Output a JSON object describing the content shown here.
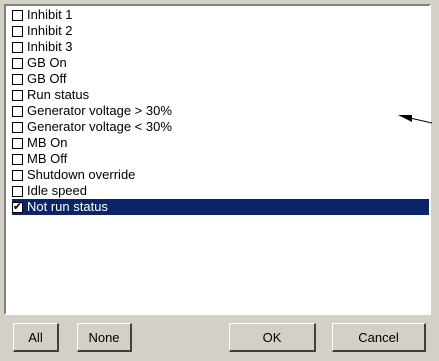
{
  "list": {
    "items": [
      {
        "label": "Inhibit 1",
        "checked": false,
        "selected": false
      },
      {
        "label": "Inhibit 2",
        "checked": false,
        "selected": false
      },
      {
        "label": "Inhibit 3",
        "checked": false,
        "selected": false
      },
      {
        "label": "GB On",
        "checked": false,
        "selected": false
      },
      {
        "label": "GB Off",
        "checked": false,
        "selected": false
      },
      {
        "label": "Run status",
        "checked": false,
        "selected": false
      },
      {
        "label": "Generator voltage > 30%",
        "checked": false,
        "selected": false
      },
      {
        "label": "Generator voltage < 30%",
        "checked": false,
        "selected": false
      },
      {
        "label": "MB On",
        "checked": false,
        "selected": false
      },
      {
        "label": "MB Off",
        "checked": false,
        "selected": false
      },
      {
        "label": "Shutdown override",
        "checked": false,
        "selected": false
      },
      {
        "label": "Idle speed",
        "checked": false,
        "selected": false
      },
      {
        "label": "Not run status",
        "checked": true,
        "selected": true
      }
    ]
  },
  "buttons": {
    "all": "All",
    "none": "None",
    "ok": "OK",
    "cancel": "Cancel"
  },
  "check_mark": "✔",
  "colors": {
    "selection_bg": "#0a246a",
    "selection_text": "#ffffff",
    "dialog_bg": "#d4d0c8"
  },
  "icons": {
    "annotation": "arrow-icon"
  }
}
